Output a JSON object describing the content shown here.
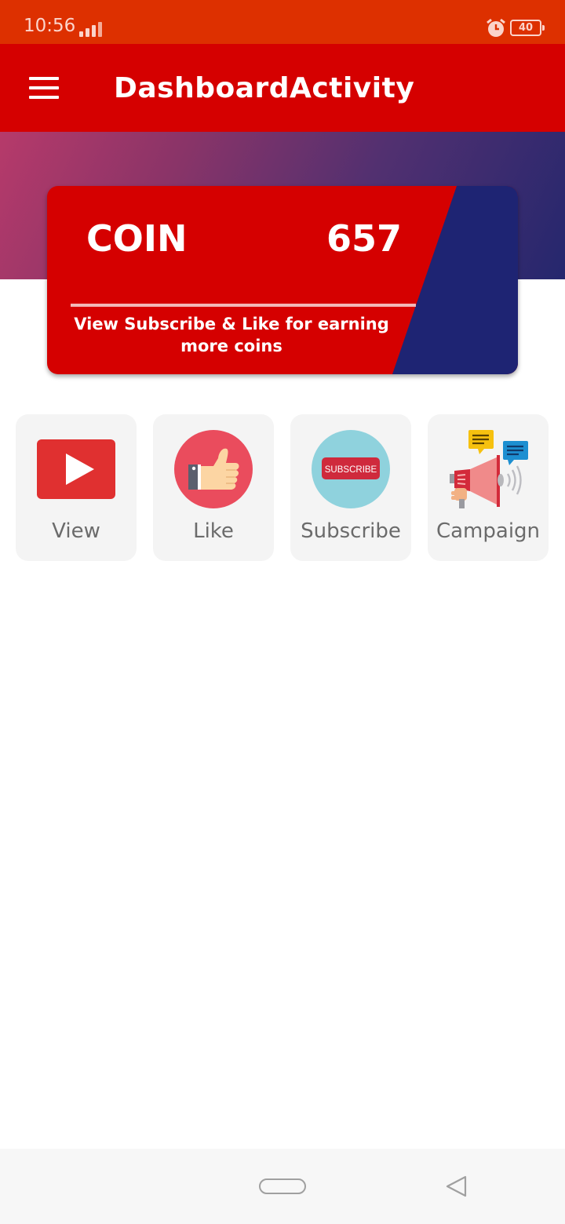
{
  "status_bar": {
    "time": "10:56",
    "battery": "40",
    "icons": [
      "signal-icon",
      "alarm-icon",
      "battery-icon"
    ]
  },
  "app_bar": {
    "title": "DashboardActivity",
    "menu_icon": "hamburger-menu-icon"
  },
  "coin_card": {
    "label": "COIN",
    "value": "657",
    "hint": "View Subscribe & Like for earning more coins"
  },
  "tiles": [
    {
      "label": "View",
      "icon": "youtube-play-icon"
    },
    {
      "label": "Like",
      "icon": "thumbs-up-icon"
    },
    {
      "label": "Subscribe",
      "icon": "subscribe-icon",
      "icon_text": "SUBSCRIBE"
    },
    {
      "label": "Campaign",
      "icon": "megaphone-icon"
    }
  ],
  "colors": {
    "status_bar": "#dd3000",
    "app_bar": "#d50000",
    "accent_navy": "#1e2473",
    "tile_background": "#f4f4f4"
  },
  "nav_bar": {
    "icons": [
      "home-pill-icon",
      "back-icon"
    ]
  }
}
